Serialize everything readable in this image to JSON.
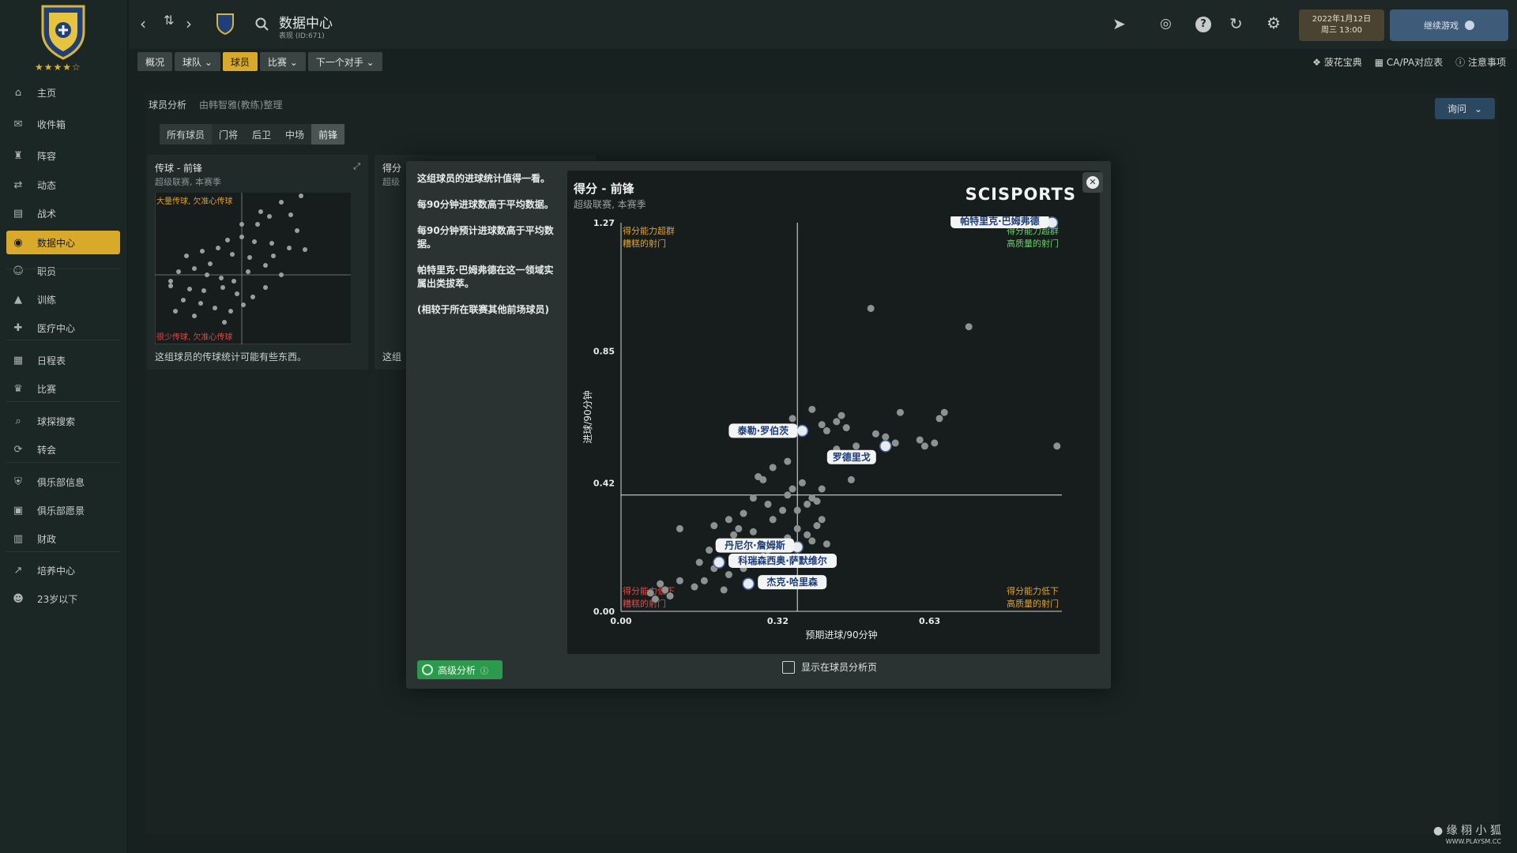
{
  "sidebar": {
    "items": [
      {
        "label": "主页",
        "icon": "home-icon"
      },
      {
        "label": "收件箱",
        "icon": "inbox-icon"
      },
      {
        "label": "阵容",
        "icon": "squad-icon"
      },
      {
        "label": "动态",
        "icon": "dynamics-icon"
      },
      {
        "label": "战术",
        "icon": "tactics-icon"
      },
      {
        "label": "数据中心",
        "icon": "data-hub-icon",
        "active": true
      },
      {
        "label": "职员",
        "icon": "staff-icon"
      },
      {
        "label": "训练",
        "icon": "training-icon"
      },
      {
        "label": "医疗中心",
        "icon": "medical-icon"
      },
      {
        "label": "日程表",
        "icon": "schedule-icon"
      },
      {
        "label": "比赛",
        "icon": "trophy-icon"
      },
      {
        "label": "球探搜索",
        "icon": "scouting-icon"
      },
      {
        "label": "转会",
        "icon": "transfers-icon"
      },
      {
        "label": "俱乐部信息",
        "icon": "club-info-icon"
      },
      {
        "label": "俱乐部愿景",
        "icon": "club-vision-icon"
      },
      {
        "label": "财政",
        "icon": "finances-icon"
      },
      {
        "label": "培养中心",
        "icon": "development-icon"
      },
      {
        "label": "23岁以下",
        "icon": "u23-icon"
      }
    ]
  },
  "header": {
    "title": "数据中心",
    "subtitle": "表现 (ID:671)",
    "date_line1": "2022年1月12日",
    "date_line2": "周三 13:00",
    "continue_label": "继续游戏"
  },
  "subtabs": [
    "概况",
    "球队",
    "球员",
    "比赛",
    "下一个对手"
  ],
  "right_links": [
    "菠花宝典",
    "CA/PA对应表",
    "注意事项"
  ],
  "analysis": {
    "title": "球员分析",
    "by": "由韩智雅(教练)整理",
    "pos_tabs": [
      "所有球员",
      "门将",
      "后卫",
      "中场",
      "前锋"
    ],
    "ask_label": "询问"
  },
  "cards": [
    {
      "title": "传球 - 前锋",
      "sub": "超级联赛, 本赛季",
      "foot": "这组球员的传球统计可能有些东西。",
      "tl": "大量传球, 欠准心传球",
      "bl": "很少传球, 欠准心传球"
    },
    {
      "title": "得分",
      "sub": "超级",
      "foot": "这组"
    }
  ],
  "modal": {
    "info": [
      "这组球员的进球统计值得一看。",
      "每90分钟进球数高于平均数据。",
      "每90分钟预计进球数高于平均数据。",
      "帕特里克·巴姆弗德在这一领域实属出类拔萃。",
      "(相较于所在联赛其他前场球员)"
    ],
    "advanced_label": "高级分析",
    "show_label": "显示在球员分析页",
    "brand": "SCISPORTS"
  },
  "chart_data": {
    "type": "scatter",
    "title": "得分 - 前锋",
    "subtitle": "超级联赛, 本赛季",
    "xlabel": "预期进球/90分钟",
    "ylabel": "进球/90分钟",
    "xlim": [
      0,
      0.9
    ],
    "ylim": [
      0,
      1.27
    ],
    "xticks": [
      "0.00",
      "0.32",
      "0.63"
    ],
    "yticks": [
      "0.00",
      "0.42",
      "0.85",
      "1.27"
    ],
    "xticks_values": [
      0,
      0.32,
      0.63
    ],
    "yticks_values": [
      0,
      0.42,
      0.85,
      1.27
    ],
    "mean_x": 0.36,
    "mean_y": 0.38,
    "quadrants": {
      "tl": "得分能力超群\n糟糕的射门",
      "tr": "得分能力超群\n高质量的射门",
      "bl": "得分能力低下\n糟糕的射门",
      "br": "得分能力低下\n高质量的射门"
    },
    "colors": {
      "tl": "#e0a030",
      "tr": "#6ccf6a",
      "bl": "#e04848",
      "br": "#e0a030"
    },
    "highlighted": [
      {
        "name": "帕特里克·巴姆弗德",
        "x": 0.88,
        "y": 1.27
      },
      {
        "name": "泰勒·罗伯茨",
        "x": 0.37,
        "y": 0.59
      },
      {
        "name": "罗德里戈",
        "x": 0.54,
        "y": 0.54
      },
      {
        "name": "丹尼尔·詹姆斯",
        "x": 0.36,
        "y": 0.21
      },
      {
        "name": "科瑞森西奥·萨默维尔",
        "x": 0.2,
        "y": 0.16
      },
      {
        "name": "杰克·哈里森",
        "x": 0.26,
        "y": 0.09
      }
    ],
    "points": [
      [
        0.51,
        0.99
      ],
      [
        0.71,
        0.93
      ],
      [
        0.89,
        0.54
      ],
      [
        0.57,
        0.65
      ],
      [
        0.66,
        0.65
      ],
      [
        0.65,
        0.63
      ],
      [
        0.39,
        0.66
      ],
      [
        0.45,
        0.64
      ],
      [
        0.44,
        0.62
      ],
      [
        0.42,
        0.59
      ],
      [
        0.35,
        0.63
      ],
      [
        0.41,
        0.61
      ],
      [
        0.46,
        0.6
      ],
      [
        0.52,
        0.58
      ],
      [
        0.54,
        0.57
      ],
      [
        0.48,
        0.54
      ],
      [
        0.44,
        0.53
      ],
      [
        0.56,
        0.55
      ],
      [
        0.61,
        0.56
      ],
      [
        0.62,
        0.54
      ],
      [
        0.64,
        0.55
      ],
      [
        0.34,
        0.49
      ],
      [
        0.31,
        0.47
      ],
      [
        0.28,
        0.44
      ],
      [
        0.29,
        0.43
      ],
      [
        0.37,
        0.42
      ],
      [
        0.35,
        0.4
      ],
      [
        0.34,
        0.38
      ],
      [
        0.41,
        0.4
      ],
      [
        0.47,
        0.43
      ],
      [
        0.4,
        0.36
      ],
      [
        0.39,
        0.37
      ],
      [
        0.38,
        0.35
      ],
      [
        0.27,
        0.37
      ],
      [
        0.3,
        0.35
      ],
      [
        0.33,
        0.33
      ],
      [
        0.25,
        0.32
      ],
      [
        0.22,
        0.3
      ],
      [
        0.19,
        0.28
      ],
      [
        0.24,
        0.27
      ],
      [
        0.27,
        0.26
      ],
      [
        0.31,
        0.3
      ],
      [
        0.36,
        0.33
      ],
      [
        0.4,
        0.28
      ],
      [
        0.38,
        0.25
      ],
      [
        0.41,
        0.3
      ],
      [
        0.36,
        0.27
      ],
      [
        0.12,
        0.27
      ],
      [
        0.2,
        0.22
      ],
      [
        0.23,
        0.25
      ],
      [
        0.18,
        0.2
      ],
      [
        0.16,
        0.16
      ],
      [
        0.19,
        0.14
      ],
      [
        0.22,
        0.12
      ],
      [
        0.17,
        0.1
      ],
      [
        0.15,
        0.08
      ],
      [
        0.12,
        0.1
      ],
      [
        0.08,
        0.09
      ],
      [
        0.09,
        0.07
      ],
      [
        0.1,
        0.05
      ],
      [
        0.06,
        0.06
      ],
      [
        0.07,
        0.04
      ],
      [
        0.3,
        0.2
      ],
      [
        0.34,
        0.24
      ],
      [
        0.39,
        0.23
      ],
      [
        0.42,
        0.22
      ],
      [
        0.29,
        0.18
      ],
      [
        0.33,
        0.16
      ],
      [
        0.25,
        0.14
      ],
      [
        0.21,
        0.07
      ]
    ]
  }
}
